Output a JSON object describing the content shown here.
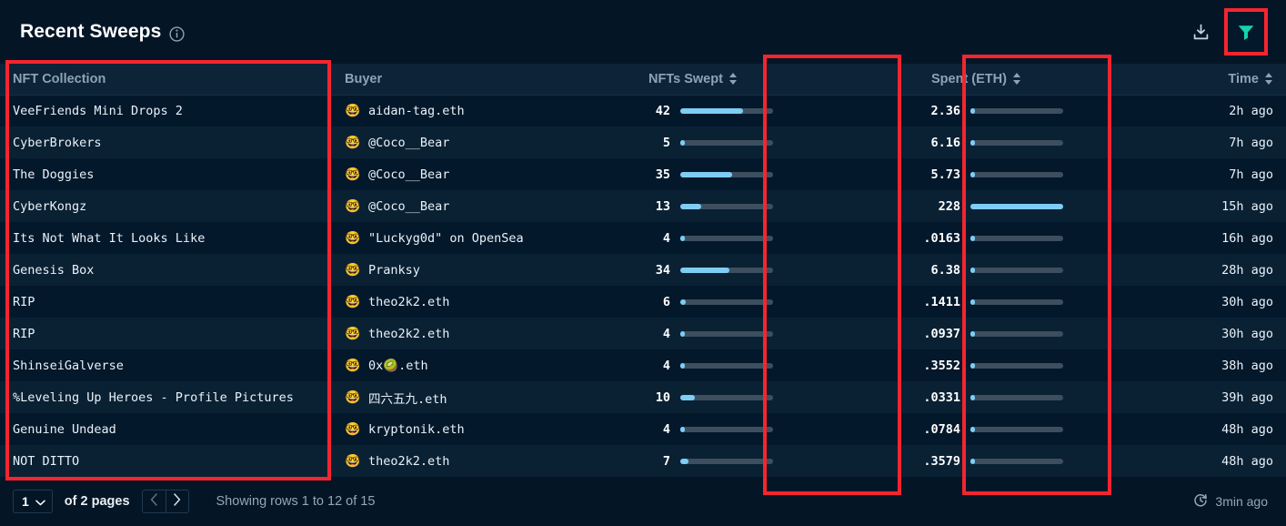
{
  "header": {
    "title": "Recent Sweeps",
    "info_icon": "info-icon",
    "download_icon": "download-icon",
    "filter_icon": "filter-icon"
  },
  "table": {
    "columns": [
      {
        "key": "collection",
        "label": "NFT Collection",
        "sortable": false
      },
      {
        "key": "buyer",
        "label": "Buyer",
        "sortable": false
      },
      {
        "key": "swept",
        "label": "NFTs Swept",
        "sortable": true
      },
      {
        "key": "spent",
        "label": "Spent (ETH)",
        "sortable": true
      },
      {
        "key": "time",
        "label": "Time",
        "sortable": true
      }
    ],
    "avatar_glyph": "🤓",
    "rows": [
      {
        "collection": "VeeFriends Mini Drops 2",
        "buyer": "aidan-tag.eth",
        "swept": "42",
        "swept_pct": 68,
        "spent": "2.36",
        "spent_pct": 3,
        "time": "2h ago"
      },
      {
        "collection": "CyberBrokers",
        "buyer": "@Coco__Bear",
        "swept": "5",
        "swept_pct": 5,
        "spent": "6.16",
        "spent_pct": 5,
        "time": "7h ago"
      },
      {
        "collection": "The Doggies",
        "buyer": "@Coco__Bear",
        "swept": "35",
        "swept_pct": 56,
        "spent": "5.73",
        "spent_pct": 4,
        "time": "7h ago"
      },
      {
        "collection": "CyberKongz",
        "buyer": "@Coco__Bear",
        "swept": "13",
        "swept_pct": 23,
        "spent": "228",
        "spent_pct": 100,
        "time": "15h ago"
      },
      {
        "collection": "Its Not What It Looks Like",
        "buyer": "\"Luckyg0d\" on OpenSea",
        "swept": "4",
        "swept_pct": 4,
        "spent": ".0163",
        "spent_pct": 0,
        "time": "16h ago"
      },
      {
        "collection": "Genesis Box",
        "buyer": "Pranksy",
        "swept": "34",
        "swept_pct": 53,
        "spent": "6.38",
        "spent_pct": 5,
        "time": "28h ago"
      },
      {
        "collection": "RIP",
        "buyer": "theo2k2.eth",
        "swept": "6",
        "swept_pct": 6,
        "spent": ".1411",
        "spent_pct": 0,
        "time": "30h ago"
      },
      {
        "collection": "RIP",
        "buyer": "theo2k2.eth",
        "swept": "4",
        "swept_pct": 4,
        "spent": ".0937",
        "spent_pct": 0,
        "time": "30h ago"
      },
      {
        "collection": "ShinseiGalverse",
        "buyer": "0x🥝.eth",
        "swept": "4",
        "swept_pct": 4,
        "spent": ".3552",
        "spent_pct": 3,
        "time": "38h ago"
      },
      {
        "collection": "%Leveling Up Heroes - Profile Pictures",
        "buyer": "四六五九.eth",
        "swept": "10",
        "swept_pct": 16,
        "spent": ".0331",
        "spent_pct": 0,
        "time": "39h ago"
      },
      {
        "collection": "Genuine Undead",
        "buyer": "kryptonik.eth",
        "swept": "4",
        "swept_pct": 4,
        "spent": ".0784",
        "spent_pct": 0,
        "time": "48h ago"
      },
      {
        "collection": "NOT DITTO",
        "buyer": "theo2k2.eth",
        "swept": "7",
        "swept_pct": 9,
        "spent": ".3579",
        "spent_pct": 3,
        "time": "48h ago"
      }
    ]
  },
  "footer": {
    "page_value": "1",
    "of_pages": "of 2 pages",
    "prev_icon": "chevron-left-icon",
    "next_icon": "chevron-right-icon",
    "showing": "Showing rows 1 to 12 of 15",
    "refresh_icon": "refresh-clock-icon",
    "refreshed": "3min ago"
  },
  "colors": {
    "accent_bar": "#7ecdf5",
    "bar_track": "#3d4f5f",
    "filter_accent": "#14d3b0",
    "highlight": "#f5252f"
  }
}
